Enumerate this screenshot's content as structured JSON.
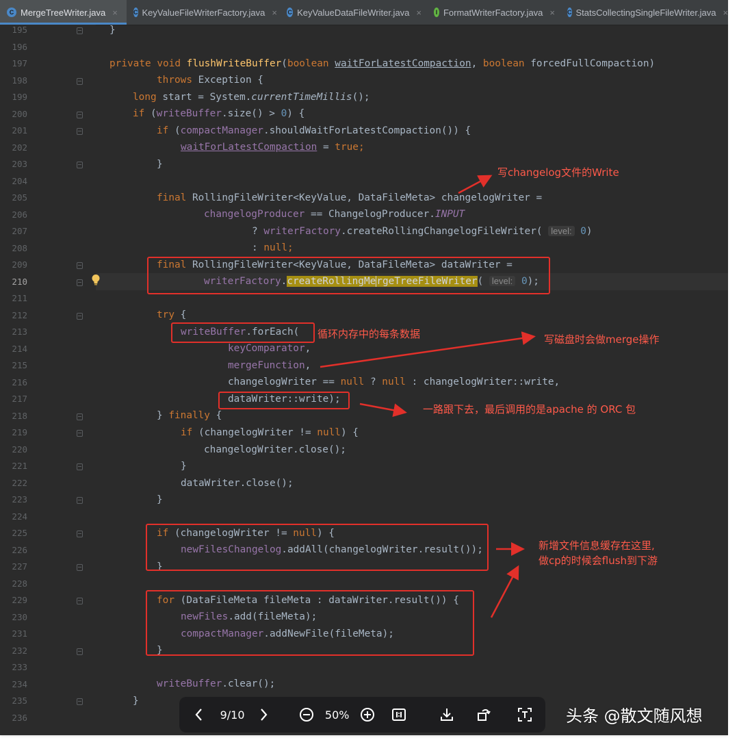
{
  "tabs": [
    {
      "label": "MergeTreeWriter.java",
      "icon": "class-icon",
      "color": "#4a88c7",
      "active": true
    },
    {
      "label": "KeyValueFileWriterFactory.java",
      "icon": "class-icon",
      "color": "#4a88c7",
      "active": false
    },
    {
      "label": "KeyValueDataFileWriter.java",
      "icon": "class-icon",
      "color": "#4a88c7",
      "active": false
    },
    {
      "label": "FormatWriterFactory.java",
      "icon": "interface-icon",
      "color": "#62b543",
      "active": false
    },
    {
      "label": "StatsCollectingSingleFileWriter.java",
      "icon": "class-icon",
      "color": "#4a88c7",
      "active": false
    }
  ],
  "line_numbers": [
    "195",
    "196",
    "197",
    "198",
    "199",
    "200",
    "201",
    "202",
    "203",
    "204",
    "205",
    "206",
    "207",
    "208",
    "209",
    "210",
    "211",
    "212",
    "213",
    "214",
    "215",
    "216",
    "217",
    "218",
    "219",
    "220",
    "221",
    "222",
    "223",
    "224",
    "225",
    "226",
    "227",
    "228",
    "229",
    "230",
    "231",
    "232",
    "233",
    "234",
    "235",
    "236"
  ],
  "current_line": "210",
  "code": {
    "l195": "}",
    "l197_private": "private",
    "l197_void": "void",
    "l197_name": "flushWriteBuffer",
    "l197_open": "(",
    "l197_bool1": "boolean",
    "l197_p1": "waitForLatestCompaction",
    "l197_comma": ",",
    "l197_bool2": "boolean",
    "l197_p2": "forcedFullCompaction)",
    "l198_throws": "throws",
    "l198_rest": "Exception {",
    "l199_long": "long",
    "l199_mid": "start = System.",
    "l199_call": "currentTimeMillis",
    "l199_end": "();",
    "l200_if": "if",
    "l200_open": "(",
    "l200_field": "writeBuffer",
    "l200_mid": ".size() > ",
    "l200_num": "0",
    "l200_end": ") {",
    "l201_if": "if",
    "l201_open": "(",
    "l201_field": "compactManager",
    "l201_end": ".shouldWaitForLatestCompaction()) {",
    "l202_var": "waitForLatestCompaction",
    "l202_eq": " = ",
    "l202_true": "true",
    "l202_semi": ";",
    "l203": "}",
    "l205_final": "final",
    "l205_rest": "RollingFileWriter<KeyValue, DataFileMeta> changelogWriter =",
    "l206_field": "changelogProducer",
    "l206_mid": " == ChangelogProducer.",
    "l206_const": "INPUT",
    "l207_q": "? ",
    "l207_field": "writerFactory",
    "l207_call": ".createRollingChangelogFileWriter(",
    "l207_hint": "level:",
    "l207_num": "0",
    "l207_end": ")",
    "l208_colon": ": ",
    "l208_null": "null",
    "l208_semi": ";",
    "l209_final": "final",
    "l209_rest": "RollingFileWriter<KeyValue, DataFileMeta> dataWriter =",
    "l210_field": "writerFactory",
    "l210_dot": ".",
    "l210_hl1": "createRollingMe",
    "l210_hl2": "rgeTreeFileWriter",
    "l210_open": "(",
    "l210_hint": "level:",
    "l210_num": "0",
    "l210_end": ");",
    "l212_try": "try",
    "l212_end": " {",
    "l213_field": "writeBuffer",
    "l213_end": ".forEach(",
    "l214_field": "keyComparator",
    "l214_end": ",",
    "l215_field": "mergeFunction",
    "l215_end": ",",
    "l216_a": "changelogWriter == ",
    "l216_null1": "null",
    "l216_b": " ? ",
    "l216_null2": "null",
    "l216_c": " : changelogWriter::write,",
    "l217": "dataWriter::write);",
    "l218_a": "} ",
    "l218_finally": "finally",
    "l218_b": " {",
    "l219_if": "if",
    "l219_a": " (changelogWriter != ",
    "l219_null": "null",
    "l219_b": ") {",
    "l220": "changelogWriter.close();",
    "l221": "}",
    "l222": "dataWriter.close();",
    "l223": "}",
    "l225_if": "if",
    "l225_a": " (changelogWriter != ",
    "l225_null": "null",
    "l225_b": ") {",
    "l226_field": "newFilesChangelog",
    "l226_end": ".addAll(changelogWriter.result());",
    "l227": "}",
    "l229_for": "for",
    "l229_rest": " (DataFileMeta fileMeta : dataWriter.result()) {",
    "l230_field": "newFiles",
    "l230_end": ".add(fileMeta);",
    "l231_field": "compactManager",
    "l231_end": ".addNewFile(fileMeta);",
    "l232": "}",
    "l234_field": "writeBuffer",
    "l234_end": ".clear();",
    "l235": "}"
  },
  "annotations": {
    "changelog_writer": "写changelog文件的Write",
    "loop_data": "循环内存中的每条数据",
    "merge_on_disk": "写磁盘时会做merge操作",
    "orc": "一路跟下去，最后调用的是apache 的 ORC 包",
    "cache_line1": "新增文件信息缓存在这里,",
    "cache_line2": "做cp的时候会flush到下游"
  },
  "viewer": {
    "page_indicator": "9/10",
    "zoom": "50%",
    "icons": [
      "prev-icon",
      "next-icon",
      "zoom-out-icon",
      "zoom-in-icon",
      "actual-size-icon",
      "download-icon",
      "rotate-icon",
      "ocr-icon"
    ]
  },
  "watermark": "头条 @散文随风想",
  "colors": {
    "annotation": "#e2302a",
    "keyword": "#cc7832",
    "field": "#9876aa",
    "function": "#ffc66d",
    "number": "#6897bb",
    "highlight": "#a68f12"
  }
}
